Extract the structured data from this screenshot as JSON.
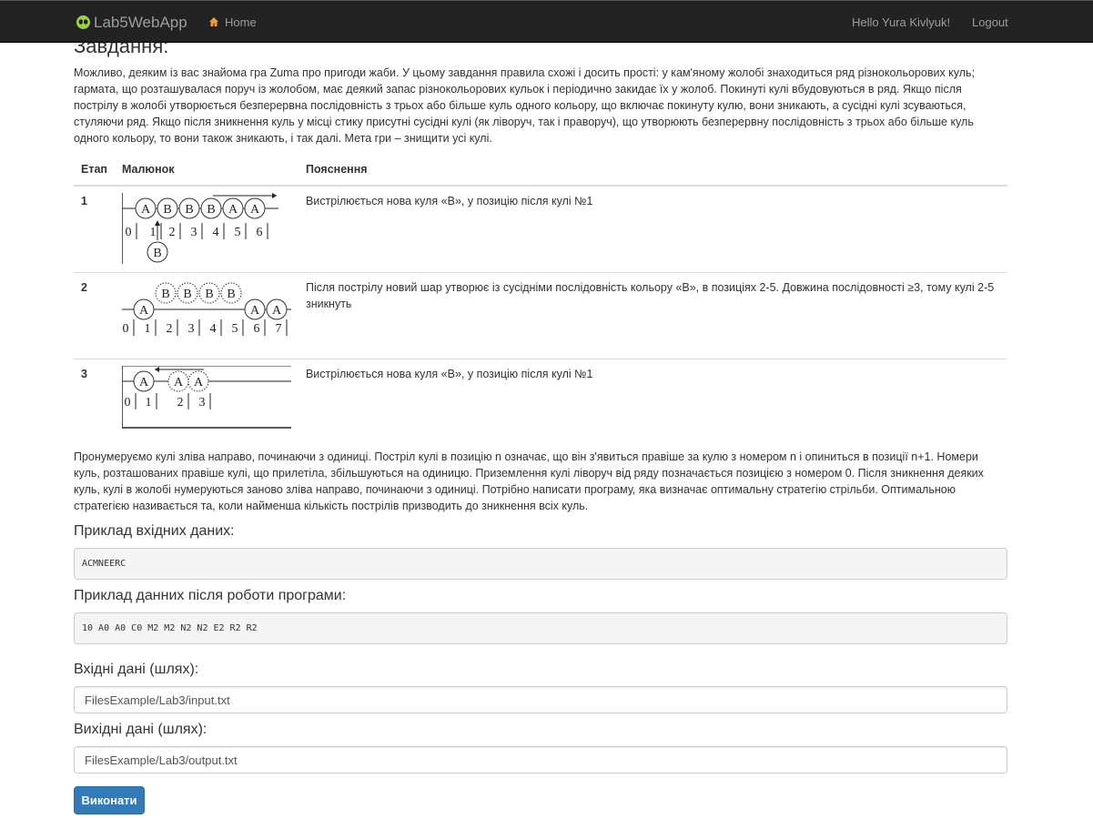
{
  "navbar": {
    "brand": "Lab5WebApp",
    "home": "Home",
    "greeting": "Hello Yura Kivlyuk!",
    "logout": "Logout",
    "background": "#222222"
  },
  "main": {
    "heading": "Завдання:",
    "intro": "Можливо, деяким із вас знайома гра Zuma про пригоди жаби. У цьому завдання правила схожі і досить прості: у кам'яному жолобі знаходиться ряд різнокольорових куль; гармата, що розташувалася поруч із жолобом, має деякий запас різнокольорових кульок і періодично закидає їх у жолоб. Покинуті кулі вбудовуються в ряд. Якщо після пострілу в жолобі утворюється безперервна послідовність з трьох або більше куль одного кольору, що включає покинуту кулю, вони зникають, а сусідні кулі зсуваються, стуляючи ряд. Якщо після зникнення куль у місці стику присутні сусідні кулі (як ліворуч, так і праворуч), що утворюють безперервну послідовність з трьох або більше куль одного кольору, то вони також зникають, і так далі. Мета гри – знищити усі кулі.",
    "table": {
      "headers": [
        "Етап",
        "Малюнок",
        "Пояснення"
      ],
      "rows": [
        {
          "stage": "1",
          "explanation": "Вистрілюється нова куля «В», у позицію після кулі №1",
          "balls": [
            "A",
            "B",
            "B",
            "B",
            "A",
            "A"
          ],
          "positions": [
            "0",
            "1",
            "2",
            "3",
            "4",
            "5",
            "6"
          ],
          "shot": "B"
        },
        {
          "stage": "2",
          "explanation": "Після пострілу новий шар утворює із сусідніми послідовність кольору «В», в позиціях 2-5. Довжина послідовності ≥3, тому кулі 2-5 зникнуть",
          "balls": [
            "A",
            "B",
            "B",
            "B",
            "B",
            "A",
            "A"
          ],
          "positions": [
            "0",
            "1",
            "2",
            "3",
            "4",
            "5",
            "6",
            "7"
          ]
        },
        {
          "stage": "3",
          "explanation": "Вистрілюється нова куля «В», у позицію після кулі №1",
          "balls": [
            "A",
            "A",
            "A"
          ],
          "positions": [
            "0",
            "1",
            "2",
            "3"
          ]
        }
      ]
    },
    "description": "Пронумеруємо кулі зліва направо, починаючи з одиниці. Постріл кулі в позицію n означає, що він з'явиться правіше за кулю з номером n і опиниться в позиції n+1. Номери куль, розташованих правіше кулі, що прилетіла, збільшуються на одиницю. Приземлення кулі ліворуч від ряду позначається позицією з номером 0. Після зникнення деяких куль, кулі в жолобі нумеруються заново зліва направо, починаючи з одиниці. Потрібно написати програму, яка визначає оптимальну стратегію стрільби. Оптимальною стратегією називається та, коли найменша кількість пострілів призводить до зникнення всіх куль.",
    "example_input_label": "Приклад вхідних даних:",
    "example_input": "ACMNEERC",
    "example_output_label": "Приклад данних після роботи програми:",
    "example_output": "10 A0 A0 C0 M2 M2 N2 N2 E2 R2 R2",
    "input_path_label": "Вхідні дані (шлях):",
    "input_path": "FilesExample/Lab3/input.txt",
    "output_path_label": "Вихідні дані (шлях):",
    "output_path": "FilesExample/Lab3/output.txt",
    "run_button": "Виконати",
    "button_color": "#337ab7"
  }
}
